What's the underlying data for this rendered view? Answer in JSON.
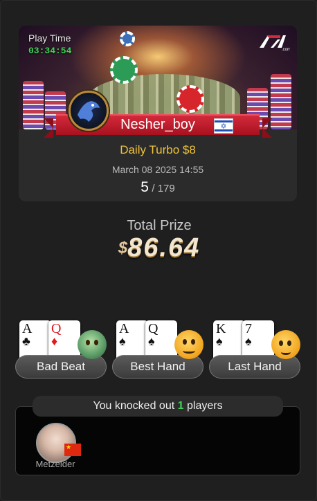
{
  "header": {
    "play_time_label": "Play Time",
    "play_time_value": "03:34:54",
    "brand_logo": "7XL.com logo",
    "username": "Nesher_boy",
    "country_flag": "israel-flag",
    "tournament_name": "Daily Turbo $8",
    "date": "March 08 2025 14:55",
    "rank_position": "5",
    "rank_total": "/ 179"
  },
  "prize": {
    "label": "Total Prize",
    "currency": "$",
    "amount": "86.64"
  },
  "hands": [
    {
      "label": "Bad Beat",
      "cards": [
        {
          "rank": "A",
          "suit": "♣"
        },
        {
          "rank": "Q",
          "suit": "♦"
        }
      ],
      "emoji": "sick-face-icon"
    },
    {
      "label": "Best Hand",
      "cards": [
        {
          "rank": "A",
          "suit": "♠"
        },
        {
          "rank": "Q",
          "suit": "♠"
        }
      ],
      "emoji": "thinking-face-icon"
    },
    {
      "label": "Last Hand",
      "cards": [
        {
          "rank": "K",
          "suit": "♠"
        },
        {
          "rank": "7",
          "suit": "♠"
        }
      ],
      "emoji": "facepalm-face-icon"
    }
  ],
  "knockouts": {
    "prefix": "You knocked out",
    "count": "1",
    "suffix": "players",
    "players": [
      {
        "name": "Metzelder",
        "flag": "china-flag"
      }
    ]
  },
  "colors": {
    "accent_gold": "#f0c43a",
    "accent_green": "#3fd457",
    "ribbon_red": "#c41e2e"
  }
}
